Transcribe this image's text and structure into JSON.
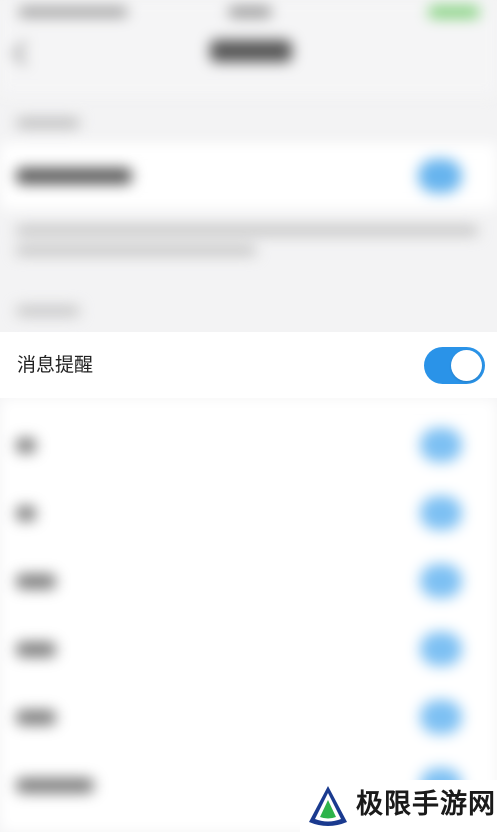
{
  "notification_setting": {
    "label": "消息提醒",
    "toggle_state": "on",
    "toggle_color": "#2a93e8"
  },
  "watermark": {
    "text": "极限手游网",
    "logo_icon": "triangle-logo-icon",
    "logo_colors": [
      "#1a3a8f",
      "#ffffff",
      "#2db34a"
    ]
  }
}
